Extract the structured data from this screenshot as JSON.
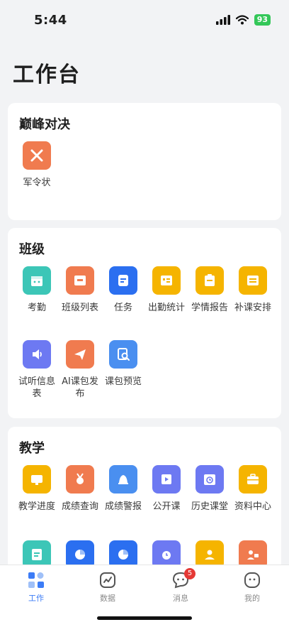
{
  "status_bar": {
    "time": "5:44",
    "battery": "93"
  },
  "page_title": "工作台",
  "sections": {
    "peak": {
      "title": "巅峰对决",
      "items": [
        {
          "label": "军令状",
          "icon": "sword-icon",
          "color": "#f07b4f"
        }
      ]
    },
    "class": {
      "title": "班级",
      "items": [
        {
          "label": "考勤",
          "icon": "calendar-icon",
          "color": "#3cc6b7"
        },
        {
          "label": "班级列表",
          "icon": "list-box-icon",
          "color": "#f07b4f"
        },
        {
          "label": "任务",
          "icon": "task-icon",
          "color": "#2b6ff0"
        },
        {
          "label": "出勤统计",
          "icon": "stats-card-icon",
          "color": "#f5b400"
        },
        {
          "label": "学情报告",
          "icon": "report-icon",
          "color": "#f5b400"
        },
        {
          "label": "补课安排",
          "icon": "schedule-icon",
          "color": "#f5b400"
        },
        {
          "label": "试听信息表",
          "icon": "speaker-icon",
          "color": "#6d79f2"
        },
        {
          "label": "AI课包发布",
          "icon": "send-icon",
          "color": "#f07b4f"
        },
        {
          "label": "课包预览",
          "icon": "preview-icon",
          "color": "#4a8ff0"
        }
      ]
    },
    "teaching": {
      "title": "教学",
      "items": [
        {
          "label": "教学进度",
          "icon": "screen-icon",
          "color": "#f5b400"
        },
        {
          "label": "成绩查询",
          "icon": "medal-icon",
          "color": "#f07b4f"
        },
        {
          "label": "成绩警报",
          "icon": "alarm-bell-icon",
          "color": "#4a8ff0"
        },
        {
          "label": "公开课",
          "icon": "video-icon",
          "color": "#6d79f2"
        },
        {
          "label": "历史课堂",
          "icon": "history-calendar-icon",
          "color": "#6d79f2"
        },
        {
          "label": "资料中心",
          "icon": "briefcase-icon",
          "color": "#f5b400"
        },
        {
          "label": "",
          "icon": "edit-doc-icon",
          "color": "#3cc6b7"
        },
        {
          "label": "",
          "icon": "pie-chart-icon",
          "color": "#2b6ff0"
        },
        {
          "label": "",
          "icon": "pie-chart-icon",
          "color": "#2b6ff0"
        },
        {
          "label": "",
          "icon": "alarm-clock-icon",
          "color": "#6d79f2"
        },
        {
          "label": "",
          "icon": "person-icon",
          "color": "#f5b400"
        },
        {
          "label": "",
          "icon": "teacher-icon",
          "color": "#f07b4f"
        }
      ]
    }
  },
  "tabs": [
    {
      "label": "工作",
      "icon": "grid-icon",
      "active": true
    },
    {
      "label": "数据",
      "icon": "chart-icon",
      "active": false
    },
    {
      "label": "消息",
      "icon": "message-icon",
      "active": false,
      "badge": "5"
    },
    {
      "label": "我的",
      "icon": "profile-icon",
      "active": false
    }
  ],
  "colors": {
    "accent": "#3c7cf6",
    "badge": "#e53935"
  }
}
